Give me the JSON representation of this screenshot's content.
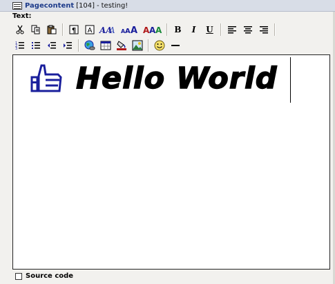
{
  "window": {
    "title_name": "Pagecontent",
    "title_id": "[104]",
    "title_separator": "-",
    "title_desc": "testing!",
    "icon": "table-icon"
  },
  "field": {
    "label": "Text:"
  },
  "toolbar": {
    "row1": [
      {
        "name": "cut",
        "icon": "scissors-icon"
      },
      {
        "name": "copy",
        "icon": "copy-icon"
      },
      {
        "name": "paste",
        "icon": "paste-icon"
      },
      {
        "name": "paragraph",
        "icon": "paragraph-icon"
      },
      {
        "name": "insert-layer",
        "icon": "text-box-icon"
      },
      {
        "name": "font-face",
        "icon": "font-face-icon"
      },
      {
        "name": "font-size",
        "icon": "font-size-icon"
      },
      {
        "name": "font-color",
        "icon": "font-color-icon"
      },
      {
        "name": "bold",
        "label": "B"
      },
      {
        "name": "italic",
        "label": "I"
      },
      {
        "name": "underline",
        "label": "U"
      },
      {
        "name": "align-left",
        "icon": "align-left-icon"
      },
      {
        "name": "align-center",
        "icon": "align-center-icon"
      },
      {
        "name": "align-right",
        "icon": "align-right-icon"
      }
    ],
    "row2": [
      {
        "name": "ordered-list",
        "icon": "ordered-list-icon"
      },
      {
        "name": "unordered-list",
        "icon": "unordered-list-icon"
      },
      {
        "name": "outdent",
        "icon": "outdent-icon"
      },
      {
        "name": "indent",
        "icon": "indent-icon"
      },
      {
        "name": "insert-link",
        "icon": "link-globe-icon"
      },
      {
        "name": "insert-table",
        "icon": "table-icon"
      },
      {
        "name": "background-color",
        "icon": "paint-bucket-icon"
      },
      {
        "name": "insert-image",
        "icon": "image-icon"
      },
      {
        "name": "insert-smiley",
        "icon": "smiley-icon"
      },
      {
        "name": "horizontal-rule",
        "icon": "horizontal-rule-icon"
      }
    ]
  },
  "editor": {
    "content_text": "Hello World",
    "content_icon": "thumbs-up-icon",
    "caret_visible": true
  },
  "source": {
    "label": "Source code",
    "checked": false
  },
  "colors": {
    "title_bg": "#d8dde7",
    "title_text": "#1d3b8a",
    "icon_blue": "#1a1f9c",
    "page_bg": "#f2f1ee"
  }
}
